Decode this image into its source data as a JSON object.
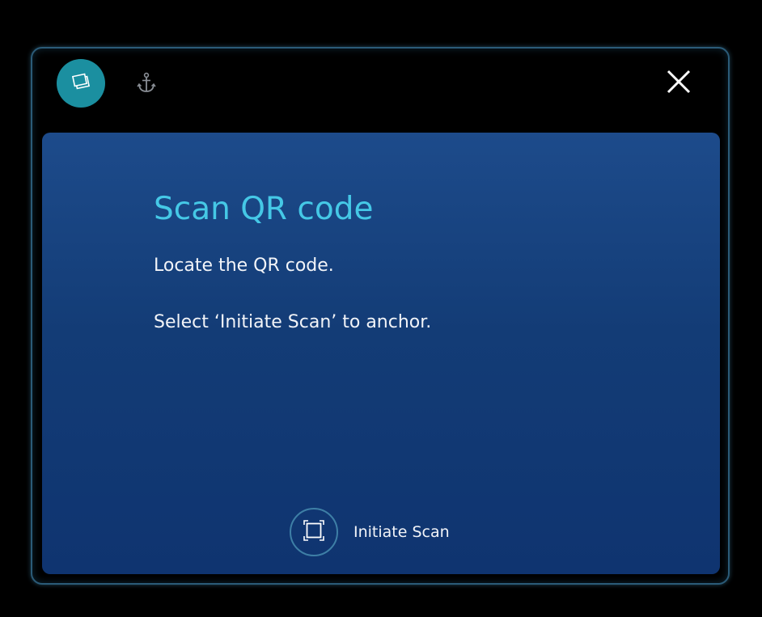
{
  "titlebar": {
    "app_icon": "stacked-panels-icon",
    "anchor_icon": "anchor-icon",
    "close_icon": "close-icon"
  },
  "dialog": {
    "title": "Scan QR code",
    "instruction_1": "Locate the QR code.",
    "instruction_2": "Select ‘Initiate Scan’ to anchor."
  },
  "actions": {
    "initiate_scan_label": "Initiate Scan",
    "initiate_scan_icon": "scan-frame-icon"
  },
  "colors": {
    "accent": "#1b8fa0",
    "title_text": "#45c8e6",
    "panel_bg": "#133c76",
    "window_bg": "#000000"
  }
}
